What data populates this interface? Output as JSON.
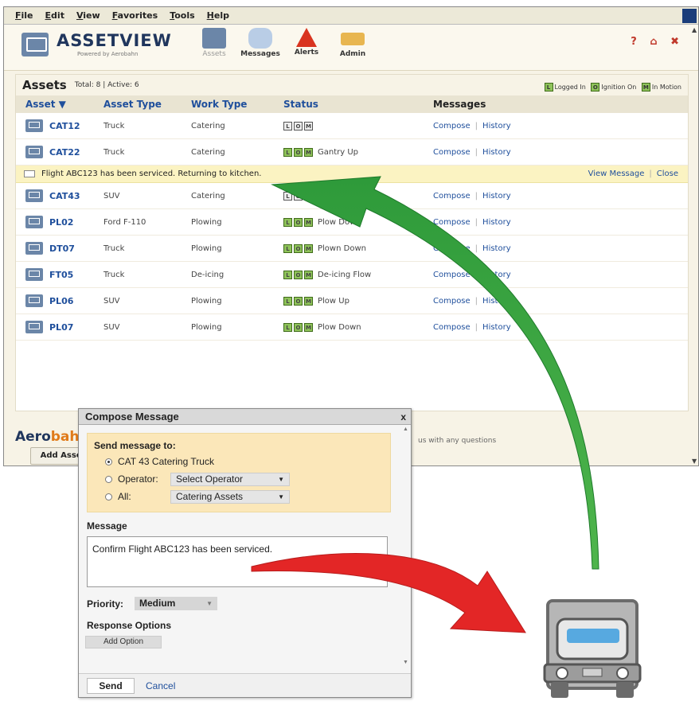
{
  "menubar": {
    "items": [
      "File",
      "Edit",
      "View",
      "Favorites",
      "Tools",
      "Help"
    ]
  },
  "header": {
    "brand": "ASSETVIEW",
    "powered_by": "Powered by Aerobahn",
    "nav": [
      "Assets",
      "Messages",
      "Alerts",
      "Admin"
    ],
    "help_icons": "? ⌂ ✖"
  },
  "assets": {
    "title": "Assets",
    "summary": "Total: 8  |  Active: 6",
    "legend": [
      {
        "letter": "L",
        "label": "Logged In"
      },
      {
        "letter": "O",
        "label": "Ignition On"
      },
      {
        "letter": "M",
        "label": "In Motion"
      }
    ],
    "columns": [
      "Asset ▼",
      "Asset Type",
      "Work Type",
      "Status",
      "Messages"
    ],
    "compose_label": "Compose",
    "history_label": "History",
    "rows": [
      {
        "name": "CAT12",
        "type": "Truck",
        "work": "Catering",
        "active": false,
        "status": ""
      },
      {
        "name": "CAT22",
        "type": "Truck",
        "work": "Catering",
        "active": true,
        "status": "Gantry Up"
      },
      {
        "name": "CAT43",
        "type": "SUV",
        "work": "Catering",
        "active": false,
        "status": ""
      },
      {
        "name": "PL02",
        "type": "Ford F-110",
        "work": "Plowing",
        "active": true,
        "status": "Plow Down"
      },
      {
        "name": "DT07",
        "type": "Truck",
        "work": "Plowing",
        "active": true,
        "status": "Plown Down"
      },
      {
        "name": "FT05",
        "type": "Truck",
        "work": "De-icing",
        "active": true,
        "status": "De-icing Flow"
      },
      {
        "name": "PL06",
        "type": "SUV",
        "work": "Plowing",
        "active": true,
        "status": "Plow Up"
      },
      {
        "name": "PL07",
        "type": "SUV",
        "work": "Plowing",
        "active": true,
        "status": "Plow Down"
      }
    ],
    "alert": {
      "text": "Flight ABC123 has been serviced. Returning to kitchen.",
      "view": "View Message",
      "close": "Close"
    },
    "add_button": "Add Asset"
  },
  "footer": {
    "brand_a": "Aero",
    "brand_b": "bahn",
    "text": "us with any questions"
  },
  "dialog": {
    "title": "Compose Message",
    "close": "x",
    "send_to_label": "Send message to:",
    "option1": "CAT 43 Catering Truck",
    "operator_label": "Operator:",
    "operator_value": "Select Operator",
    "all_label": "All:",
    "all_value": "Catering Assets",
    "message_label": "Message",
    "message_text": "Confirm Flight ABC123 has been serviced.",
    "priority_label": "Priority:",
    "priority_value": "Medium",
    "response_label": "Response Options",
    "add_option": "Add Option",
    "send": "Send",
    "cancel": "Cancel"
  },
  "colors": {
    "accent": "#1f4f9c",
    "alert": "#fbf3c2",
    "sendto_bg": "#fbe7b9",
    "green_arrow": "#2e9a3a",
    "red_arrow": "#e32626"
  }
}
